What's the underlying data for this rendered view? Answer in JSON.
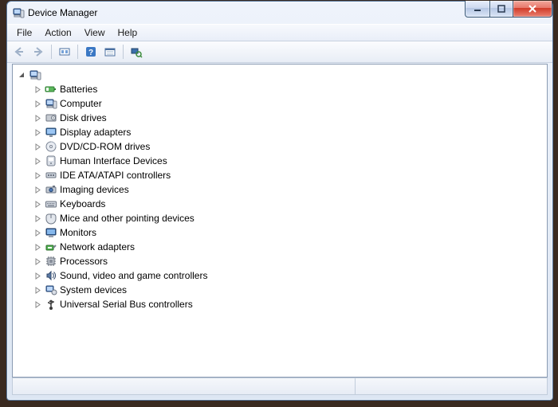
{
  "window": {
    "title": "Device Manager"
  },
  "menu": {
    "file": "File",
    "action": "Action",
    "view": "View",
    "help": "Help"
  },
  "toolbar": {
    "back": "Back",
    "forward": "Forward",
    "show_hidden": "Show hidden devices",
    "help": "Help",
    "properties": "Properties",
    "scan": "Scan for hardware changes"
  },
  "tree": {
    "root": {
      "label": "",
      "expanded": true
    },
    "items": [
      {
        "label": "Batteries",
        "icon": "battery"
      },
      {
        "label": "Computer",
        "icon": "computer"
      },
      {
        "label": "Disk drives",
        "icon": "disk"
      },
      {
        "label": "Display adapters",
        "icon": "display"
      },
      {
        "label": "DVD/CD-ROM drives",
        "icon": "optical"
      },
      {
        "label": "Human Interface Devices",
        "icon": "hid"
      },
      {
        "label": "IDE ATA/ATAPI controllers",
        "icon": "ide"
      },
      {
        "label": "Imaging devices",
        "icon": "imaging"
      },
      {
        "label": "Keyboards",
        "icon": "keyboard"
      },
      {
        "label": "Mice and other pointing devices",
        "icon": "mouse"
      },
      {
        "label": "Monitors",
        "icon": "monitor"
      },
      {
        "label": "Network adapters",
        "icon": "network"
      },
      {
        "label": "Processors",
        "icon": "cpu"
      },
      {
        "label": "Sound, video and game controllers",
        "icon": "sound"
      },
      {
        "label": "System devices",
        "icon": "system"
      },
      {
        "label": "Universal Serial Bus controllers",
        "icon": "usb"
      }
    ]
  }
}
